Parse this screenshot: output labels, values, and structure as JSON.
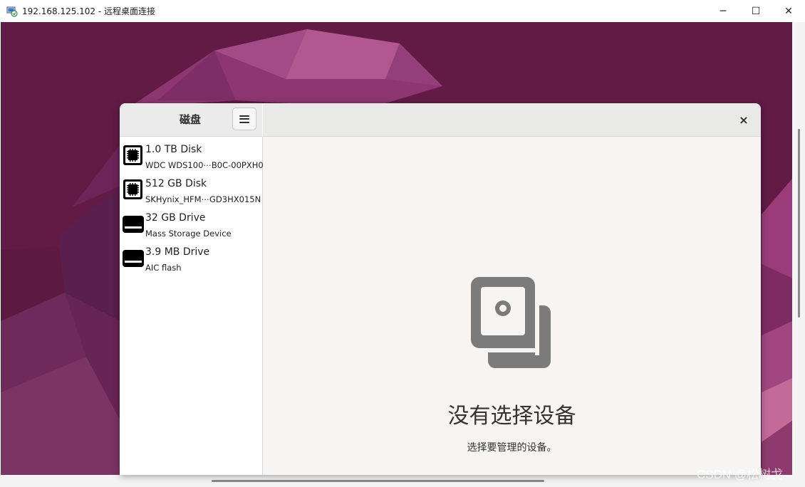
{
  "window": {
    "title": "192.168.125.102 - 远程桌面连接",
    "icon": "remote-desktop-icon",
    "controls": {
      "minimize": "─",
      "maximize": "☐",
      "close": "✕"
    }
  },
  "disks_app": {
    "sidebar_title": "磁盘",
    "menu_icon": "hamburger-menu-icon",
    "close_label": "×",
    "drives": [
      {
        "name": "1.0 TB Disk",
        "detail": "WDC WDS100⋯B0C-00PXH0",
        "icon": "chip-disk-icon"
      },
      {
        "name": "512 GB Disk",
        "detail": "SKHynix_HFM⋯GD3HX015N",
        "icon": "chip-disk-icon"
      },
      {
        "name": "32 GB Drive",
        "detail": "Mass Storage Device",
        "icon": "removable-drive-icon"
      },
      {
        "name": "3.9 MB Drive",
        "detail": "AIC flash",
        "icon": "removable-drive-icon"
      }
    ],
    "empty_state": {
      "icon": "drive-multiple-icon",
      "title": "没有选择设备",
      "subtitle": "选择要管理的设备。"
    }
  },
  "watermark": "CSDN @松树戈",
  "colors": {
    "wallpaper": "#5e1a42",
    "sidebar_bg": "#ffffff",
    "main_bg": "#f6f5f4",
    "icon_gray": "#7b7b7b"
  }
}
